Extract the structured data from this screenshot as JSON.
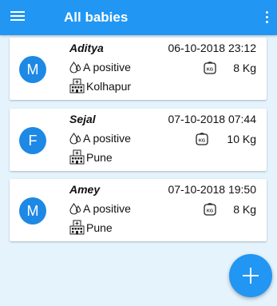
{
  "appbar": {
    "title": "All babies",
    "menu_icon": "hamburger-menu-icon",
    "overflow_icon": "more-vert-icon",
    "color": "#2196f3"
  },
  "babies": [
    {
      "avatar_letter": "M",
      "name": "Aditya",
      "datetime": "06-10-2018 23:12",
      "blood_group": "A positive",
      "weight": "8 Kg",
      "location": "Kolhapur"
    },
    {
      "avatar_letter": "F",
      "name": "Sejal",
      "datetime": "07-10-2018 07:44",
      "blood_group": "A positive",
      "weight": "10 Kg",
      "location": "Pune"
    },
    {
      "avatar_letter": "M",
      "name": "Amey",
      "datetime": "07-10-2018 19:50",
      "blood_group": "A positive",
      "weight": "8 Kg",
      "location": "Pune"
    }
  ],
  "fab": {
    "icon": "add-icon"
  },
  "colors": {
    "accent": "#2196f3",
    "avatar": "#1e88e5",
    "background": "#e5f3fd"
  }
}
